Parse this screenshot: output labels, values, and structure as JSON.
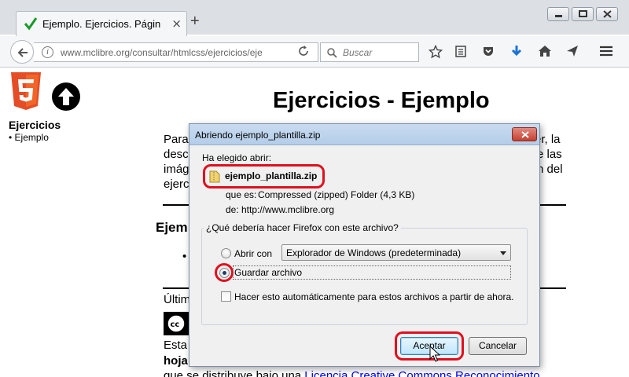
{
  "browser": {
    "tab_title": "Ejemplo. Ejercicios. Página",
    "new_tab": "+",
    "url_domain": "www.mclibre.org",
    "url_path": "/consultar/htmlcss/ejercicios/eje",
    "url_prefix": "www.",
    "search_placeholder": "Buscar"
  },
  "page": {
    "title": "Ejercicios - Ejemplo",
    "sidebar_title": "Ejercicios",
    "sidebar_item": "• Ejemplo",
    "frag_para": "Para",
    "frag_desc": "desc",
    "frag_imag": "imág",
    "frag_ejer": "ejerc",
    "frag_er_la": "er, la",
    "frag_e_las": "e las",
    "frag_n_del": "n del",
    "frag_ejem": "Ejem",
    "frag_bullet": "•",
    "frag_ultim": "Últim",
    "frag_esta": "Esta",
    "frag_hoja": "hoja",
    "frag_bottom": "que se distribuye bajo una",
    "frag_link": "Licencia Creative Commons Reconocimiento"
  },
  "dialog": {
    "title": "Abriendo ejemplo_plantilla.zip",
    "chosen_label": "Ha elegido abrir:",
    "filename": "ejemplo_plantilla.zip",
    "type_label": "que es:",
    "type_value": "Compressed (zipped) Folder (4,3 KB)",
    "from_label": "de:",
    "from_value": "http://www.mclibre.org",
    "question": "¿Qué debería hacer Firefox con este archivo?",
    "open_with_label": "Abrir con",
    "open_with_value": "Explorador de Windows (predeterminada)",
    "save_label": "Guardar archivo",
    "auto_label": "Hacer esto automáticamente para estos archivos a partir de ahora.",
    "accept_label": "Aceptar",
    "cancel_label": "Cancelar"
  },
  "colors": {
    "highlight": "#e0101f",
    "html5_orange": "#e44d26",
    "link_blue": "#0000ee"
  }
}
